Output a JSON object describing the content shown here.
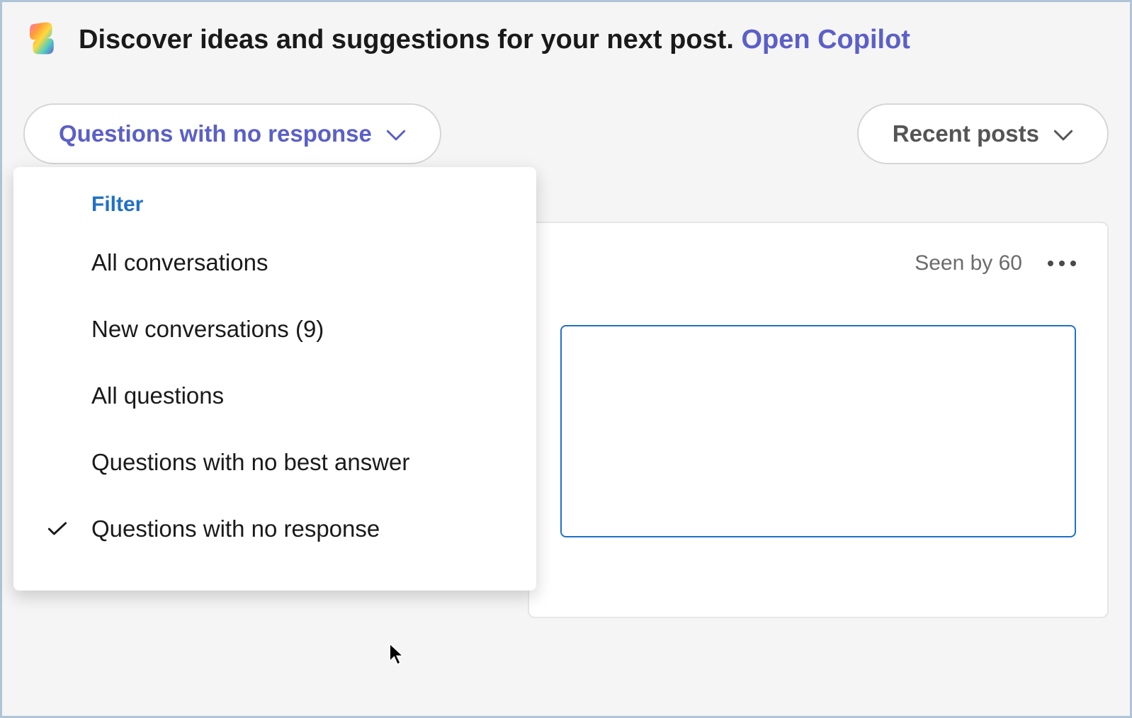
{
  "banner": {
    "text": "Discover ideas and suggestions for your next post. ",
    "link": "Open Copilot"
  },
  "filter_dropdown": {
    "selected": "Questions with no response",
    "header": "Filter",
    "items": [
      {
        "label": "All conversations",
        "checked": false
      },
      {
        "label": "New conversations (9)",
        "checked": false
      },
      {
        "label": "All questions",
        "checked": false
      },
      {
        "label": "Questions with no best answer",
        "checked": false
      },
      {
        "label": "Questions with no response",
        "checked": true
      }
    ]
  },
  "sort_dropdown": {
    "selected": "Recent posts"
  },
  "post": {
    "seen_by": "Seen by 60"
  }
}
